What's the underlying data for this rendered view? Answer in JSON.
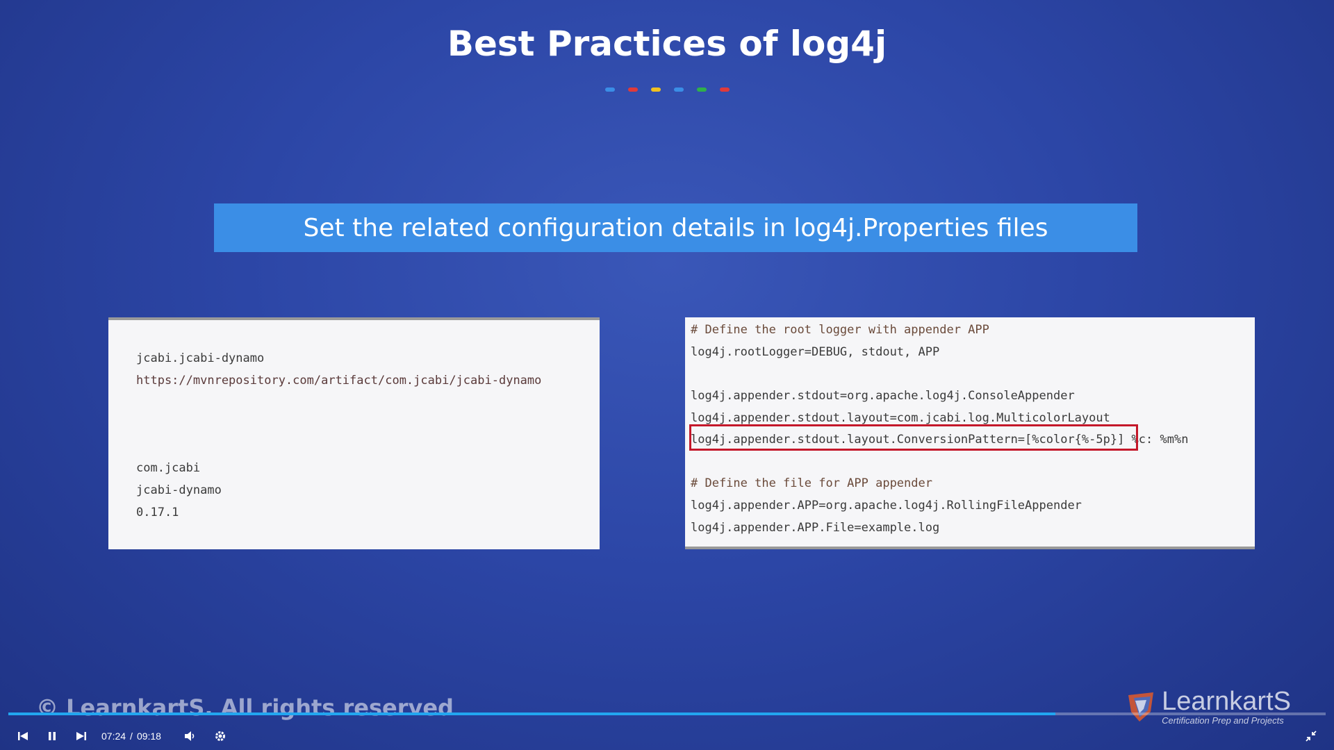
{
  "slide": {
    "title": "Best Practices of log4j",
    "dot_colors": [
      "#3b8ee6",
      "#e03a3a",
      "#f0c020",
      "#3b8ee6",
      "#2fb04a",
      "#e03a3a"
    ],
    "banner_text": "Set the related configuration details in log4j.Properties files",
    "banner_color": "#3b8ee6"
  },
  "left_panel": {
    "lines": [
      "jcabi.jcabi-dynamo",
      "https://mvnrepository.com/artifact/com.jcabi/jcabi-dynamo",
      "com.jcabi",
      "jcabi-dynamo",
      "0.17.1"
    ]
  },
  "right_panel": {
    "lines": [
      "# Define the root logger with appender APP",
      "log4j.rootLogger=DEBUG, stdout, APP",
      "log4j.appender.stdout=org.apache.log4j.ConsoleAppender",
      "log4j.appender.stdout.layout=com.jcabi.log.MulticolorLayout",
      "log4j.appender.stdout.layout.ConversionPattern=[%color{%-5p}] %c: %m%n",
      "# Define the file for APP appender",
      "log4j.appender.APP=org.apache.log4j.RollingFileAppender",
      "log4j.appender.APP.File=example.log"
    ],
    "highlight_color": "#c4182a"
  },
  "watermark": "© LearnkartS. All rights reserved",
  "brand": {
    "name": "LearnkartS",
    "tagline": "Certification Prep and Projects"
  },
  "player": {
    "current_time": "07:24",
    "separator": "/",
    "duration": "09:18",
    "progress_fraction": 0.795,
    "icons": {
      "previous": "skip-previous-icon",
      "pause": "pause-icon",
      "next": "skip-next-icon",
      "volume": "volume-icon",
      "settings": "gear-icon",
      "fullscreen": "exit-fullscreen-icon"
    }
  }
}
